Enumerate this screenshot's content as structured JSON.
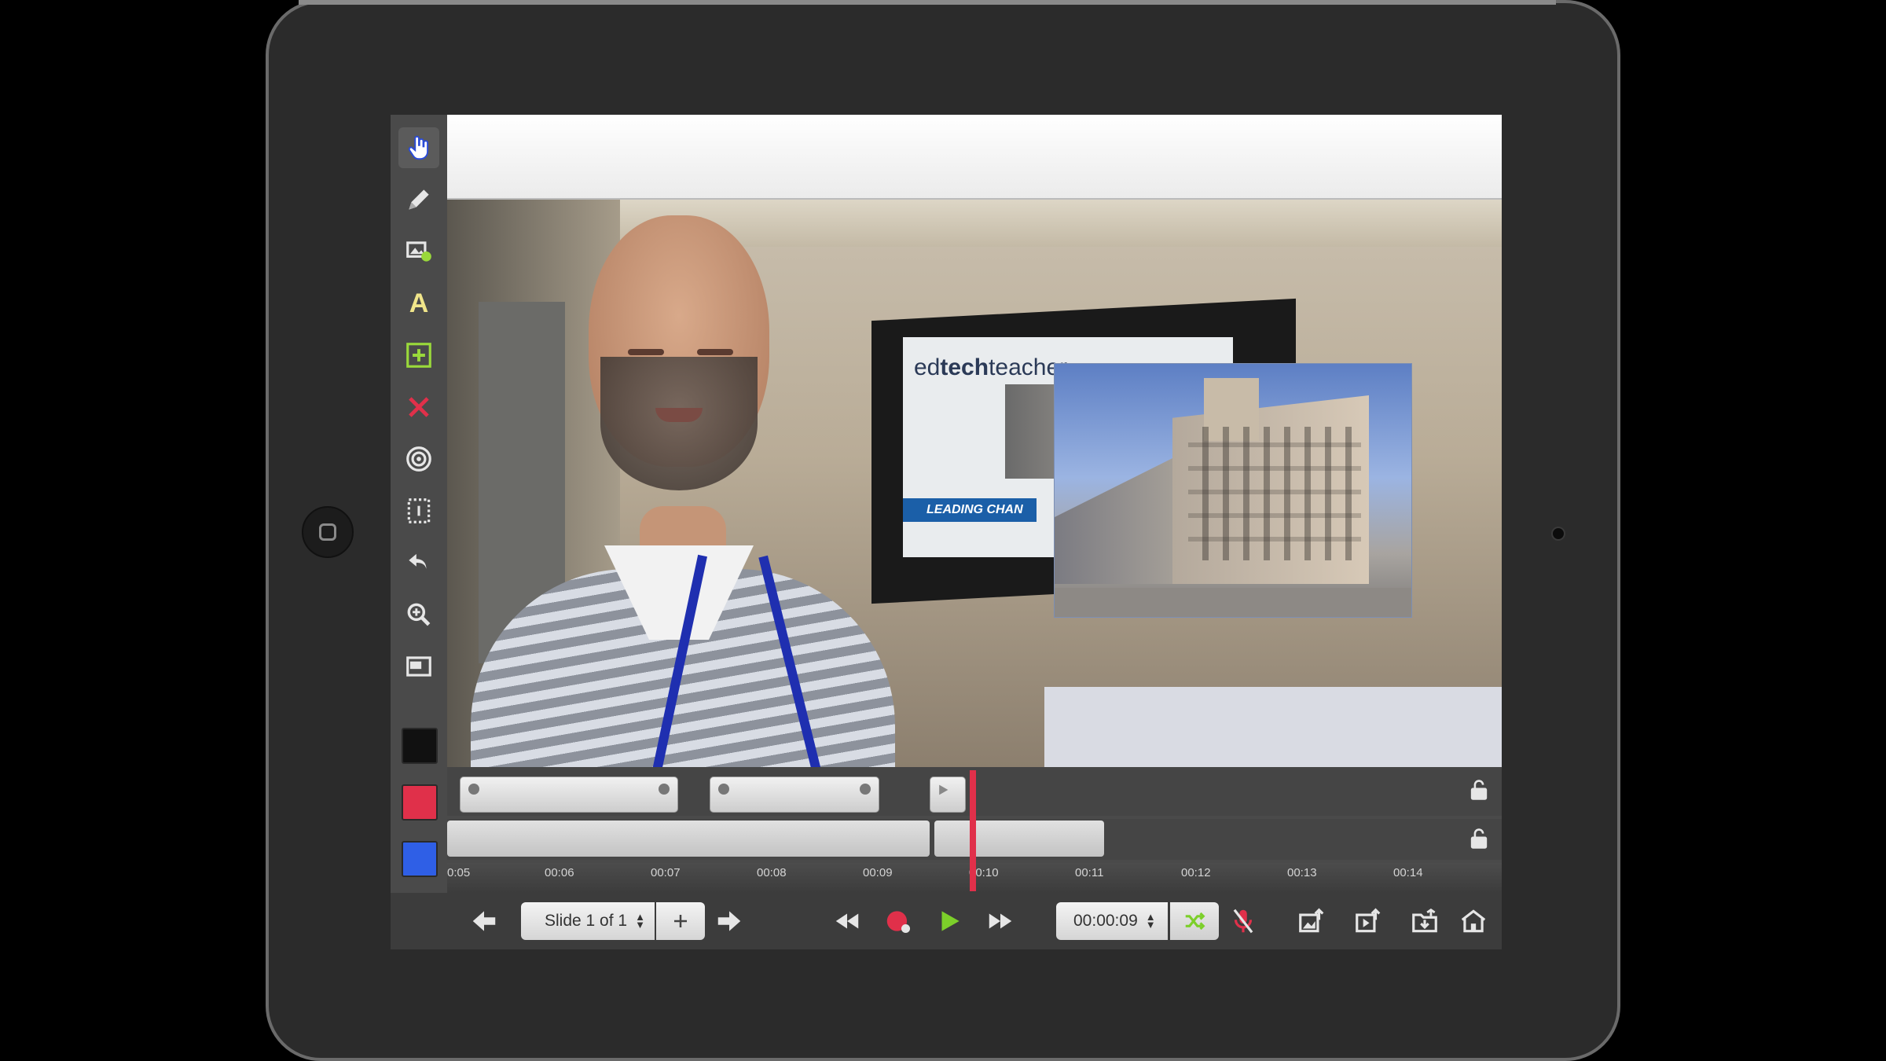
{
  "device": {
    "home_button": "home-button-icon",
    "camera": "camera-icon"
  },
  "sidebar": {
    "tools": [
      {
        "name": "hand-pointer-icon"
      },
      {
        "name": "pencil-icon"
      },
      {
        "name": "insert-media-icon"
      },
      {
        "name": "text-tool-icon",
        "label": "A"
      },
      {
        "name": "add-element-icon"
      },
      {
        "name": "delete-icon"
      },
      {
        "name": "laser-pointer-icon"
      },
      {
        "name": "selection-icon"
      },
      {
        "name": "undo-icon"
      },
      {
        "name": "zoom-icon"
      },
      {
        "name": "layout-icon"
      }
    ],
    "colors": [
      "#111111",
      "#e0304a",
      "#2f5fe6"
    ]
  },
  "canvas": {
    "banner_logo_prefix": "ed",
    "banner_logo_bold": "tech",
    "banner_logo_suffix": "teacher",
    "banner_strip": "LEADING CHAN"
  },
  "timeline": {
    "ticks": [
      "0:05",
      "00:06",
      "00:07",
      "00:08",
      "00:09",
      "00:10",
      "00:11",
      "00:12",
      "00:13",
      "00:14"
    ],
    "playhead_time": "00:10"
  },
  "bottombar": {
    "slide_label": "Slide 1 of 1",
    "time_value": "00:00:09"
  },
  "accent": {
    "record": "#e0304a",
    "play": "#7ccf2a",
    "shuffle": "#7ccf2a",
    "mic_off": "#e0304a"
  }
}
